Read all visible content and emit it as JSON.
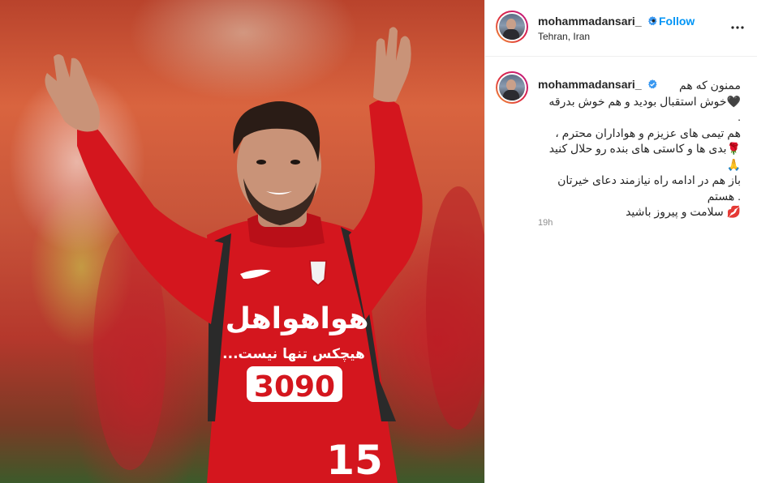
{
  "post": {
    "username": "mohammadansari_",
    "location": "Tehran, Iran",
    "follow_label": "Follow",
    "separator": "•",
    "timestamp": "19h"
  },
  "caption": {
    "lines": [
      "ممنون که هم",
      "🖤خوش استقبال بودید و هم خوش بدرقه",
      ".",
      "هم تیمی های عزیزم و هواداران محترم ،",
      "🌹بدی ها و کاستی های بنده رو حلال کنید",
      "🙏",
      "باز هم در ادامه راه نیازمند دعای خیرتان",
      ". هستم",
      "💋 سلامت و پیروز باشید"
    ]
  },
  "photo": {
    "sponsor_text": "هواهواهل",
    "slogan_text": "هیچکس تنها نیست...",
    "phone_text": "3090",
    "jersey_number": "15"
  },
  "colors": {
    "follow_blue": "#0095f6",
    "verified_blue": "#3897f0",
    "jersey_red": "#d4161e",
    "muted_gray": "#8e8e8e"
  },
  "icons": {
    "verified": "verified-badge-icon",
    "more": "more-options-icon"
  }
}
